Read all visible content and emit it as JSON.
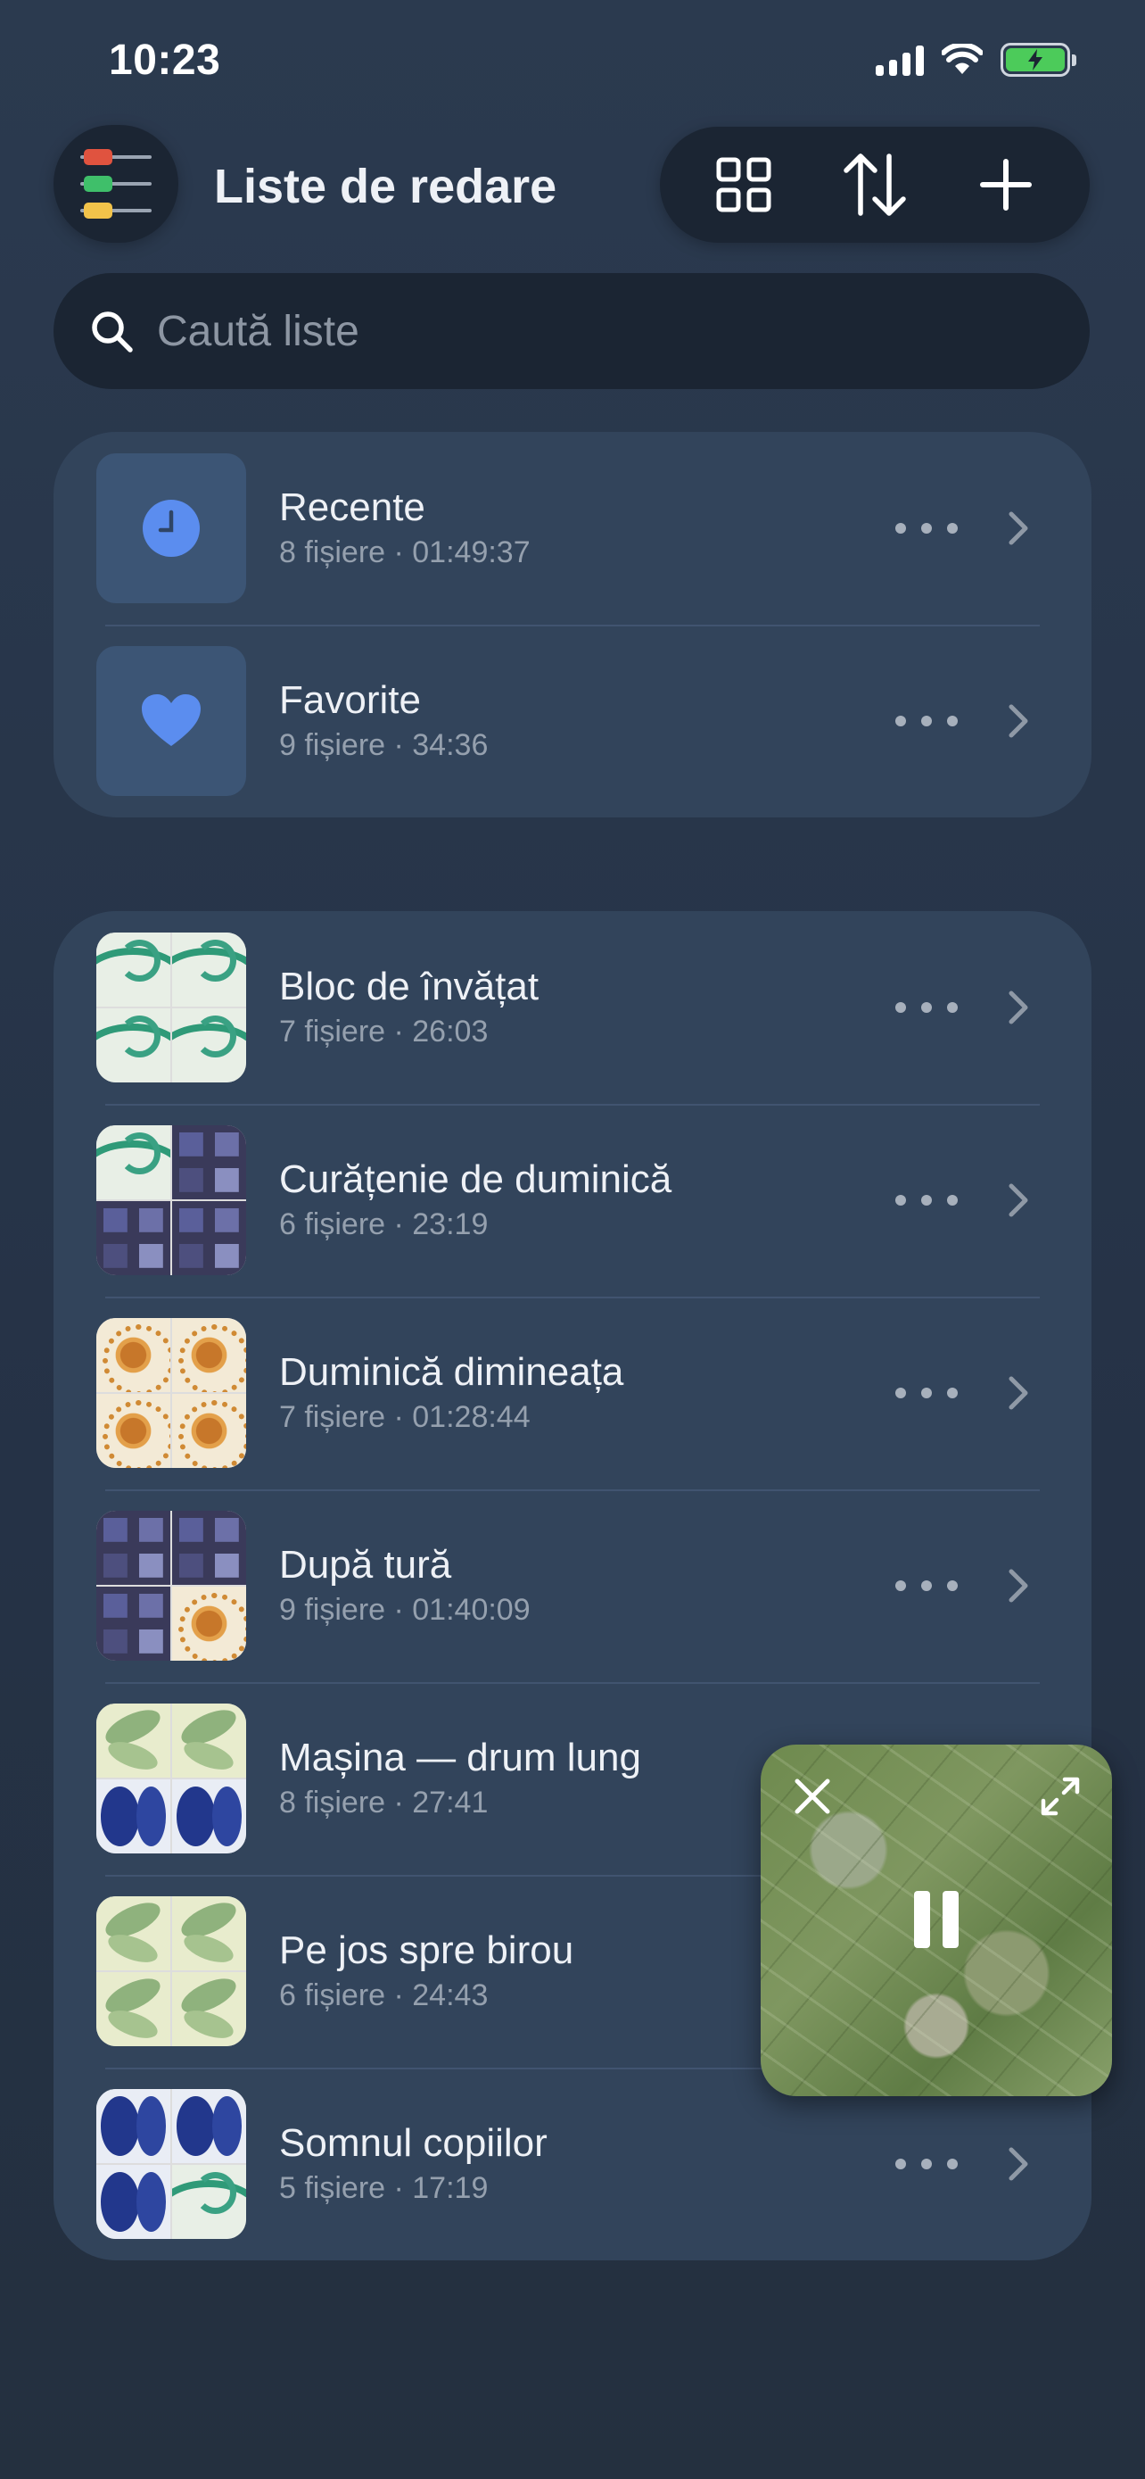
{
  "status_bar": {
    "time": "10:23"
  },
  "header": {
    "title": "Liste de redare"
  },
  "search": {
    "placeholder": "Caută liste"
  },
  "system_lists": [
    {
      "title": "Recente",
      "subtitle": "8 fișiere · 01:49:37",
      "icon": "clock-icon"
    },
    {
      "title": "Favorite",
      "subtitle": "9 fișiere · 34:36",
      "icon": "heart-icon"
    }
  ],
  "playlists": [
    {
      "title": "Bloc de învățat",
      "subtitle": "7 fișiere · 26:03",
      "tiles": [
        "wave",
        "wave",
        "wave",
        "wave"
      ]
    },
    {
      "title": "Curățenie de duminică",
      "subtitle": "6 fișiere · 23:19",
      "tiles": [
        "wave",
        "window",
        "window",
        "window"
      ]
    },
    {
      "title": "Duminică dimineața",
      "subtitle": "7 fișiere · 01:28:44",
      "tiles": [
        "sun",
        "sun",
        "sun",
        "sun"
      ]
    },
    {
      "title": "După tură",
      "subtitle": "9 fișiere · 01:40:09",
      "tiles": [
        "window",
        "window",
        "window",
        "sun"
      ]
    },
    {
      "title": "Mașina — drum lung",
      "subtitle": "8 fișiere · 27:41",
      "tiles": [
        "leaf",
        "leaf",
        "blue",
        "blue"
      ]
    },
    {
      "title": "Pe jos spre birou",
      "subtitle": "6 fișiere · 24:43",
      "tiles": [
        "leaf",
        "leaf",
        "leaf",
        "leaf"
      ]
    },
    {
      "title": "Somnul copiilor",
      "subtitle": "5 fișiere · 17:19",
      "tiles": [
        "blue",
        "blue",
        "blue",
        "wave"
      ]
    }
  ],
  "mini_player": {
    "state": "playing"
  },
  "colors": {
    "accent": "#5b8def",
    "menu_chip_red": "#e0533f",
    "menu_chip_green": "#3fbf6a",
    "menu_chip_yellow": "#f2c34a",
    "battery": "#4ccb5a"
  }
}
